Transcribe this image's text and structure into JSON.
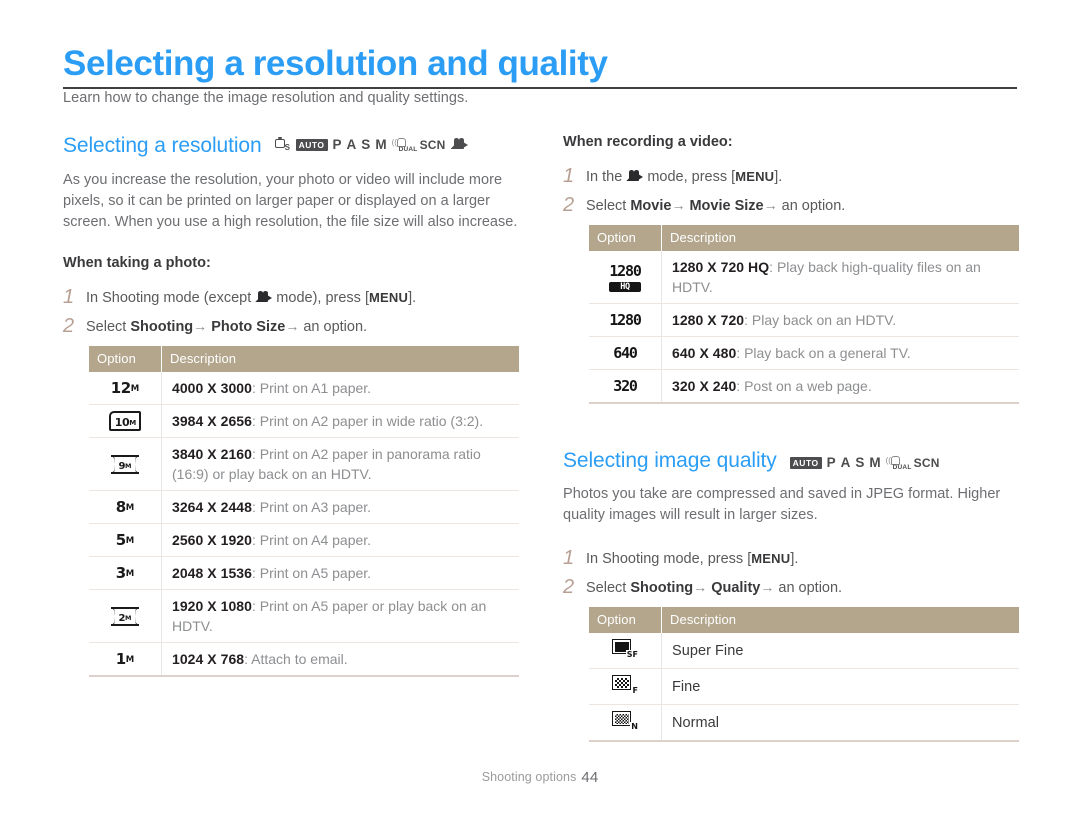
{
  "page": {
    "title": "Selecting a resolution and quality",
    "subtitle": "Learn how to change the image resolution and quality settings.",
    "accent_color": "#2b9df4",
    "table_header_color": "#b3a68c",
    "step_number_color": "#b79f93"
  },
  "footer": {
    "section": "Shooting options",
    "page_number": "44"
  },
  "section_resolution": {
    "heading": "Selecting a resolution",
    "modes": [
      "smart-auto",
      "AUTO",
      "P",
      "A",
      "S",
      "M",
      "dual-is",
      "SCN",
      "movie"
    ],
    "body": "As you increase the resolution, your photo or video will include more pixels, so it can be printed on larger paper or displayed on a larger screen. When you use a high resolution, the file size will also increase.",
    "photo_label": "When taking a photo:",
    "steps": [
      {
        "num": "1",
        "pre": "In Shooting mode (except ",
        "icon": "movie-icon",
        "post_plain": " mode), press [",
        "key": "MENU",
        "tail": "]."
      },
      {
        "num": "2",
        "pre": "Select ",
        "b1": "Shooting",
        "arrow1": "→",
        "b2": "Photo Size",
        "arrow2": "→",
        "tail": " an option."
      }
    ],
    "table": {
      "headers": [
        "Option",
        "Description"
      ],
      "rows": [
        {
          "icon_kind": "plain",
          "icon_num": "12",
          "icon_sup": "M",
          "value": "4000 X 3000",
          "desc": ": Print on A1 paper."
        },
        {
          "icon_kind": "box32",
          "icon_num": "10",
          "icon_sup": "M",
          "value": "3984 X 2656",
          "desc": ": Print on A2 paper in wide ratio (3:2)."
        },
        {
          "icon_kind": "box169",
          "icon_num": "9",
          "icon_sup": "M",
          "value": "3840 X 2160",
          "desc": ": Print on A2 paper in panorama ratio (16:9) or play back on an HDTV."
        },
        {
          "icon_kind": "plain",
          "icon_num": "8",
          "icon_sup": "M",
          "value": "3264 X 2448",
          "desc": ": Print on A3 paper."
        },
        {
          "icon_kind": "plain",
          "icon_num": "5",
          "icon_sup": "M",
          "value": "2560 X 1920",
          "desc": ": Print on A4 paper."
        },
        {
          "icon_kind": "plain",
          "icon_num": "3",
          "icon_sup": "M",
          "value": "2048 X 1536",
          "desc": ": Print on A5 paper."
        },
        {
          "icon_kind": "box169",
          "icon_num": "2",
          "icon_sup": "M",
          "value": "1920 X 1080",
          "desc": ": Print on A5 paper or play back on an HDTV."
        },
        {
          "icon_kind": "plain",
          "icon_num": "1",
          "icon_sup": "M",
          "value": "1024 X 768",
          "desc": ": Attach to email."
        }
      ]
    }
  },
  "section_video": {
    "video_label": "When recording a video:",
    "steps": [
      {
        "num": "1",
        "pre": "In the ",
        "icon": "movie-icon",
        "post_plain": " mode, press [",
        "key": "MENU",
        "tail": "]."
      },
      {
        "num": "2",
        "pre": "Select ",
        "b1": "Movie",
        "arrow1": "→",
        "b2": "Movie Size",
        "arrow2": "→",
        "tail": " an option."
      }
    ],
    "table": {
      "headers": [
        "Option",
        "Description"
      ],
      "rows": [
        {
          "icon_kind": "lcd-hq",
          "icon_num": "1280",
          "icon_tag": "HQ",
          "value": "1280 X 720 HQ",
          "desc": ": Play back high-quality files on an HDTV."
        },
        {
          "icon_kind": "lcd",
          "icon_num": "1280",
          "value": "1280 X 720",
          "desc": ": Play back on an HDTV."
        },
        {
          "icon_kind": "lcd",
          "icon_num": "640",
          "value": "640 X 480",
          "desc": ": Play back on a general TV."
        },
        {
          "icon_kind": "lcd",
          "icon_num": "320",
          "value": "320 X 240",
          "desc": ": Post on a web page."
        }
      ]
    }
  },
  "section_quality": {
    "heading": "Selecting image quality",
    "modes": [
      "AUTO",
      "P",
      "A",
      "S",
      "M",
      "dual-is",
      "SCN"
    ],
    "body": "Photos you take are compressed and saved in JPEG format. Higher quality images will result in larger sizes.",
    "steps": [
      {
        "num": "1",
        "pre": "In Shooting mode, press [",
        "key": "MENU",
        "tail": "]."
      },
      {
        "num": "2",
        "pre": "Select ",
        "b1": "Shooting",
        "arrow1": "→",
        "b2": "Quality",
        "arrow2": "→",
        "tail": " an option."
      }
    ],
    "table": {
      "headers": [
        "Option",
        "Description"
      ],
      "rows": [
        {
          "icon_kind": "q-sf",
          "icon_sub": "SF",
          "label": "Super Fine"
        },
        {
          "icon_kind": "q-f",
          "icon_sub": "F",
          "label": "Fine"
        },
        {
          "icon_kind": "q-n",
          "icon_sub": "N",
          "label": "Normal"
        }
      ]
    }
  }
}
